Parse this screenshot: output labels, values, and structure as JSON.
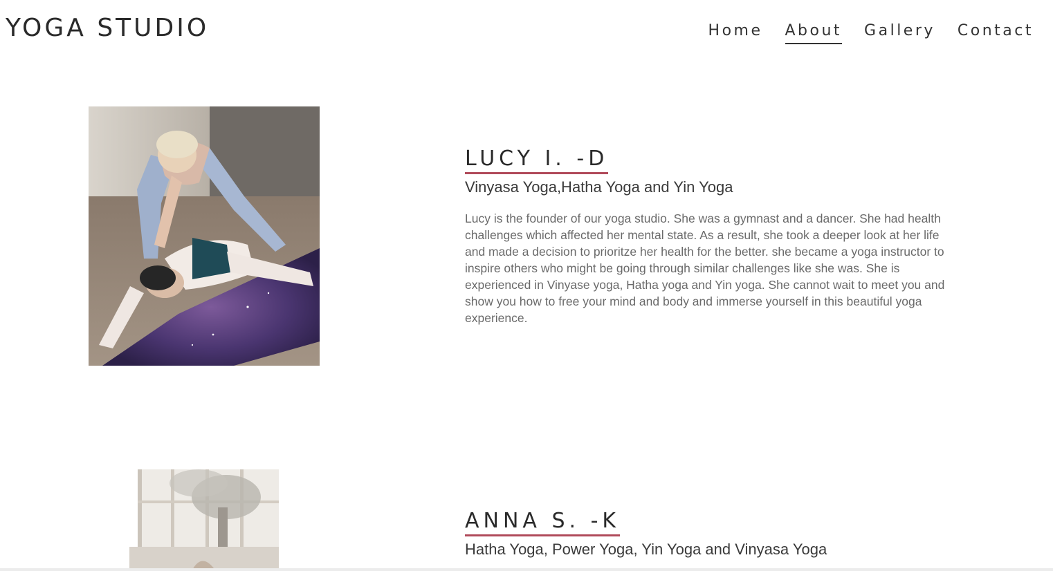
{
  "header": {
    "logo": "YOGA STUDIO",
    "nav": [
      {
        "label": "Home",
        "active": false
      },
      {
        "label": "About",
        "active": true
      },
      {
        "label": "Gallery",
        "active": false
      },
      {
        "label": "Contact",
        "active": false
      }
    ]
  },
  "profiles": [
    {
      "name": "LUCY I. -D",
      "styles": "Vinyasa Yoga,Hatha Yoga and Yin Yoga",
      "bio": "Lucy is the founder of our yoga studio. She was a gymnast and a dancer. She had health challenges which affected her mental state. As a result, she took a deeper look at her life and made a decision to prioritze her health for the better. she became a yoga instructor to inspire others who might be going through similar challenges like she was. She is experienced in Vinyase yoga, Hatha yoga and Yin yoga. She cannot wait to meet you and show you how to free your mind and body and immerse yourself in this beautiful yoga experience."
    },
    {
      "name": "ANNA S. -K",
      "styles": "Hatha Yoga, Power Yoga, Yin Yoga and Vinyasa Yoga"
    }
  ],
  "colors": {
    "name_underline": "#b04a5a",
    "text_primary": "#333333",
    "text_muted": "#6a6a6a"
  }
}
